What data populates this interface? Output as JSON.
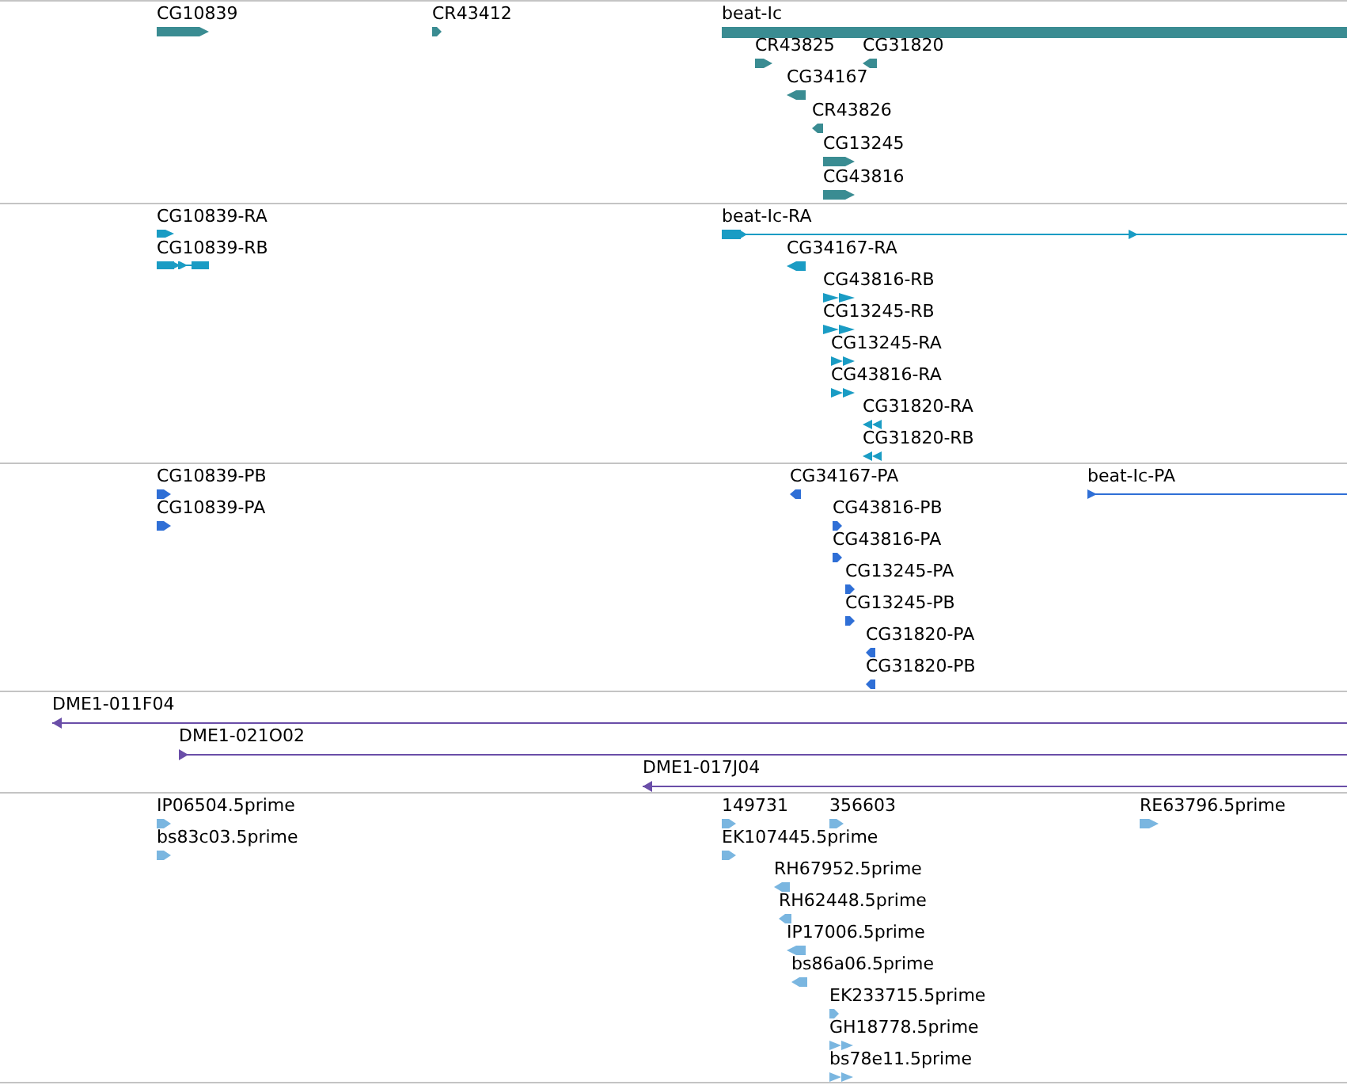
{
  "tracks": [
    {
      "color": "#3a8c92",
      "features": [
        {
          "label": "CG10839",
          "reverse": false,
          "kind": "block"
        },
        {
          "label": "CR43412",
          "reverse": false,
          "kind": "block"
        },
        {
          "label": "beat-Ic",
          "reverse": false,
          "kind": "block"
        },
        {
          "label": "CR43825",
          "reverse": false,
          "kind": "block"
        },
        {
          "label": "CG31820",
          "reverse": true,
          "kind": "block"
        },
        {
          "label": "CG34167",
          "reverse": true,
          "kind": "block"
        },
        {
          "label": "CR43826",
          "reverse": true,
          "kind": "block"
        },
        {
          "label": "CG13245",
          "reverse": false,
          "kind": "block"
        },
        {
          "label": "CG43816",
          "reverse": false,
          "kind": "block"
        }
      ]
    },
    {
      "color": "#1a9cc4",
      "features": [
        {
          "label": "CG10839-RA",
          "reverse": false,
          "kind": "block"
        },
        {
          "label": "CG10839-RB",
          "reverse": false,
          "kind": "spliced"
        },
        {
          "label": "beat-Ic-RA",
          "reverse": false,
          "kind": "spliced"
        },
        {
          "label": "CG34167-RA",
          "reverse": true,
          "kind": "block"
        },
        {
          "label": "CG43816-RB",
          "reverse": false,
          "kind": "double"
        },
        {
          "label": "CG13245-RB",
          "reverse": false,
          "kind": "double"
        },
        {
          "label": "CG13245-RA",
          "reverse": false,
          "kind": "double"
        },
        {
          "label": "CG43816-RA",
          "reverse": false,
          "kind": "double"
        },
        {
          "label": "CG31820-RA",
          "reverse": true,
          "kind": "double"
        },
        {
          "label": "CG31820-RB",
          "reverse": true,
          "kind": "double"
        }
      ]
    },
    {
      "color": "#2f6fd6",
      "features": [
        {
          "label": "CG10839-PB",
          "reverse": false,
          "kind": "block"
        },
        {
          "label": "CG10839-PA",
          "reverse": false,
          "kind": "block"
        },
        {
          "label": "CG34167-PA",
          "reverse": true,
          "kind": "block"
        },
        {
          "label": "beat-Ic-PA",
          "reverse": false,
          "kind": "line"
        },
        {
          "label": "CG43816-PB",
          "reverse": false,
          "kind": "block"
        },
        {
          "label": "CG43816-PA",
          "reverse": false,
          "kind": "block"
        },
        {
          "label": "CG13245-PA",
          "reverse": false,
          "kind": "block"
        },
        {
          "label": "CG13245-PB",
          "reverse": false,
          "kind": "block"
        },
        {
          "label": "CG31820-PA",
          "reverse": true,
          "kind": "block"
        },
        {
          "label": "CG31820-PB",
          "reverse": true,
          "kind": "block"
        }
      ]
    },
    {
      "color": "#6a4ea8",
      "features": [
        {
          "label": "DME1-011F04",
          "reverse": true,
          "kind": "line"
        },
        {
          "label": "DME1-021O02",
          "reverse": false,
          "kind": "line"
        },
        {
          "label": "DME1-017J04",
          "reverse": true,
          "kind": "line"
        }
      ]
    },
    {
      "color": "#7ab6e0",
      "features": [
        {
          "label": "IP06504.5prime",
          "reverse": false,
          "kind": "block"
        },
        {
          "label": "bs83c03.5prime",
          "reverse": false,
          "kind": "block"
        },
        {
          "label": "149731",
          "reverse": false,
          "kind": "block"
        },
        {
          "label": "356603",
          "reverse": false,
          "kind": "block"
        },
        {
          "label": "RE63796.5prime",
          "reverse": false,
          "kind": "block"
        },
        {
          "label": "EK107445.5prime",
          "reverse": false,
          "kind": "block"
        },
        {
          "label": "RH67952.5prime",
          "reverse": true,
          "kind": "block"
        },
        {
          "label": "RH62448.5prime",
          "reverse": true,
          "kind": "block"
        },
        {
          "label": "IP17006.5prime",
          "reverse": true,
          "kind": "block"
        },
        {
          "label": "bs86a06.5prime",
          "reverse": true,
          "kind": "block"
        },
        {
          "label": "EK233715.5prime",
          "reverse": false,
          "kind": "block"
        },
        {
          "label": "GH18778.5prime",
          "reverse": false,
          "kind": "double"
        },
        {
          "label": "bs78e11.5prime",
          "reverse": false,
          "kind": "double"
        }
      ]
    }
  ]
}
